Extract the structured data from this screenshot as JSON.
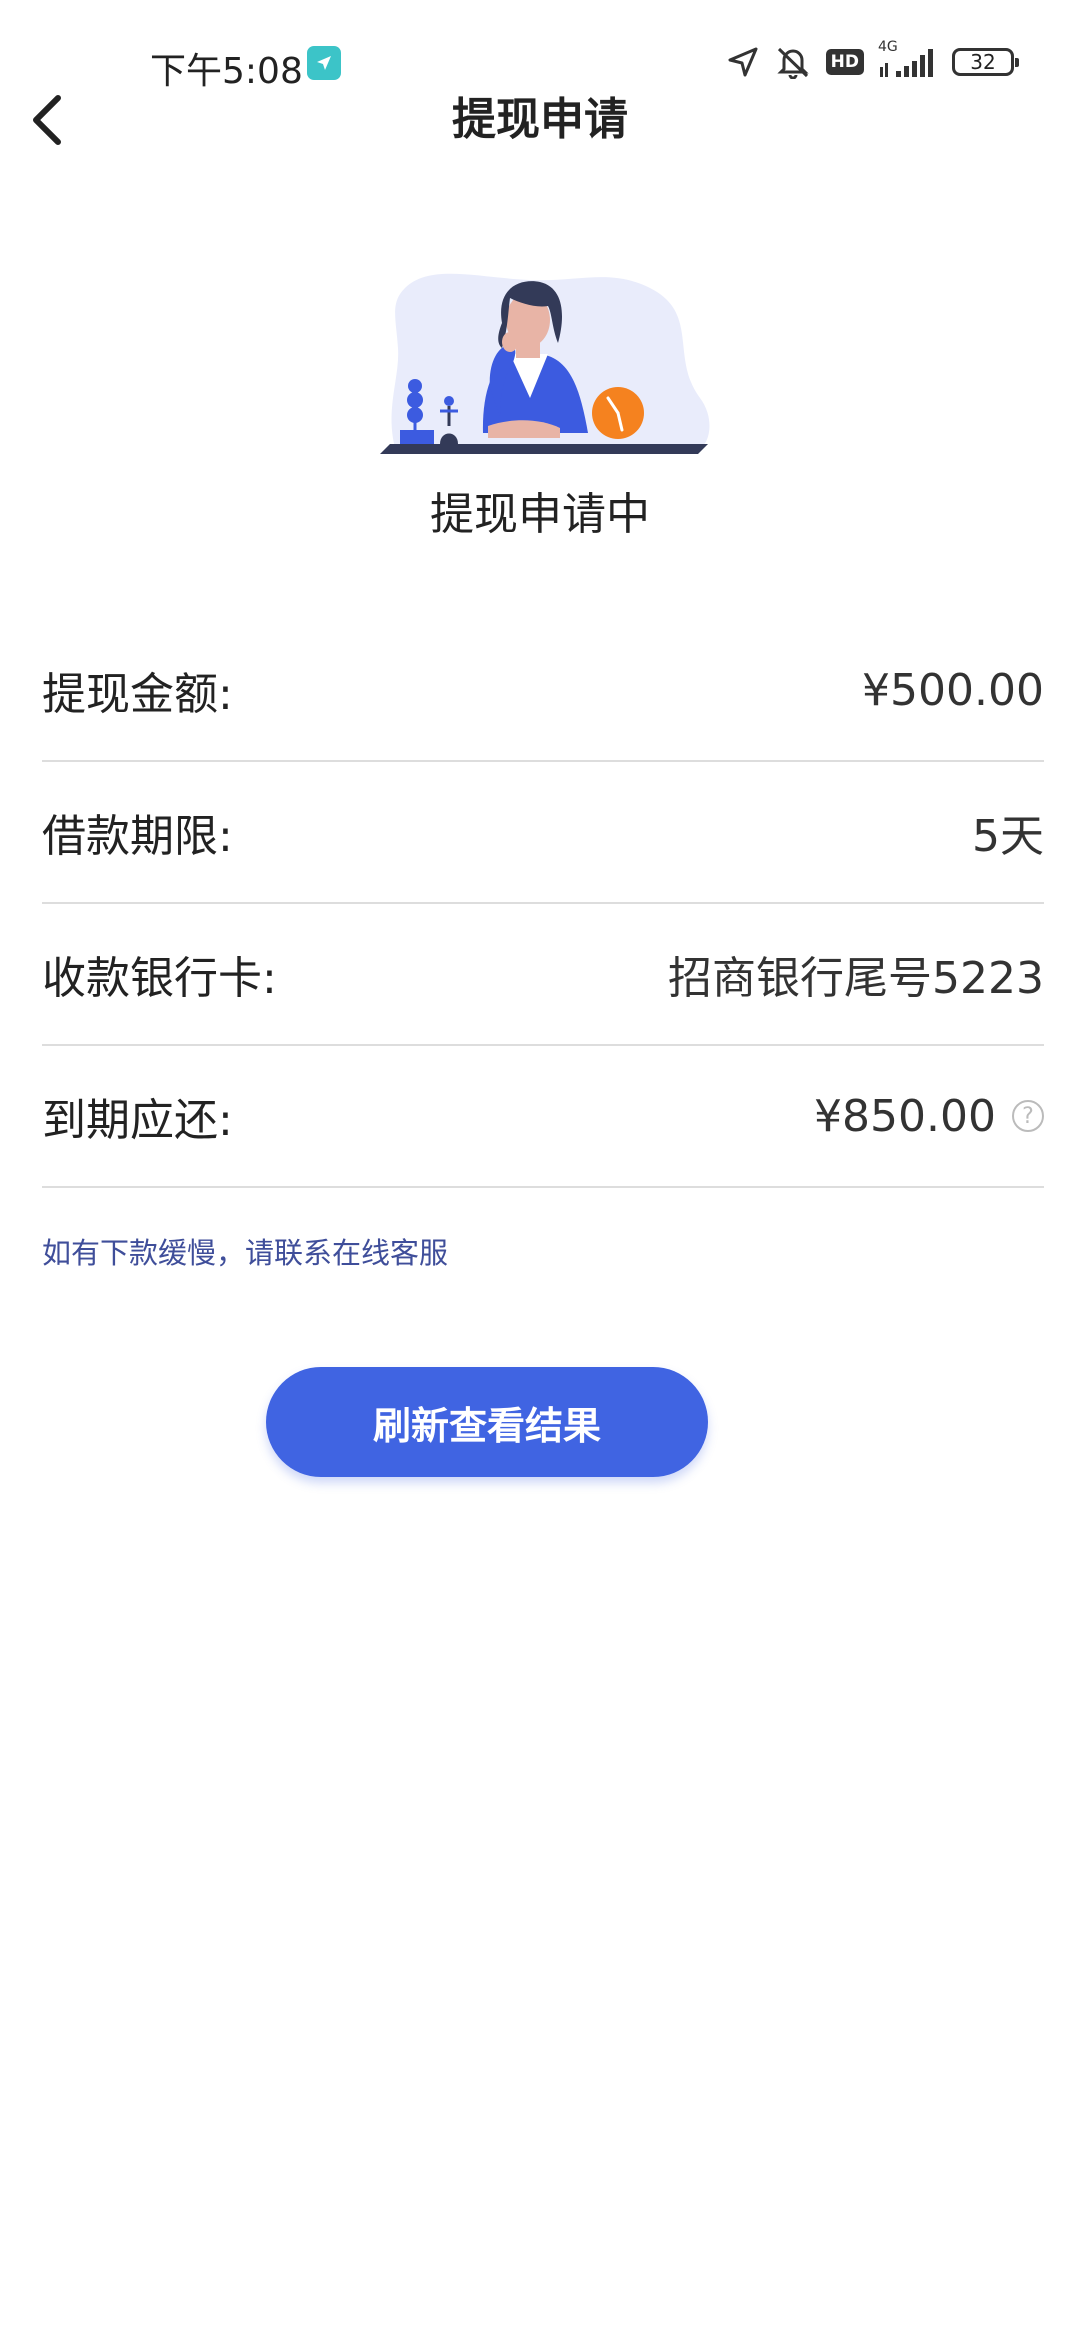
{
  "status_bar": {
    "time": "下午5:08",
    "hd_label": "HD",
    "network": "4G",
    "battery": "32",
    "icons": [
      "location-arrow-icon",
      "bell-muted-icon",
      "hd-icon",
      "signal-icon",
      "battery-icon"
    ]
  },
  "header": {
    "title": "提现申请",
    "back_icon": "chevron-left-icon"
  },
  "status": {
    "text": "提现申请中"
  },
  "info": {
    "rows": [
      {
        "label": "提现金额:",
        "value": "¥500.00"
      },
      {
        "label": "借款期限:",
        "value": "5天"
      },
      {
        "label": "收款银行卡:",
        "value": "招商银行尾号5223"
      },
      {
        "label": "到期应还:",
        "value": "¥850.00"
      }
    ],
    "help_symbol": "?"
  },
  "notice": "如有下款缓慢，请联系在线客服",
  "refresh_button": "刷新查看结果",
  "colors": {
    "accent": "#4064e2",
    "notice": "#3f4e9a",
    "divider": "#dddddd",
    "clock": "#f5821f"
  }
}
